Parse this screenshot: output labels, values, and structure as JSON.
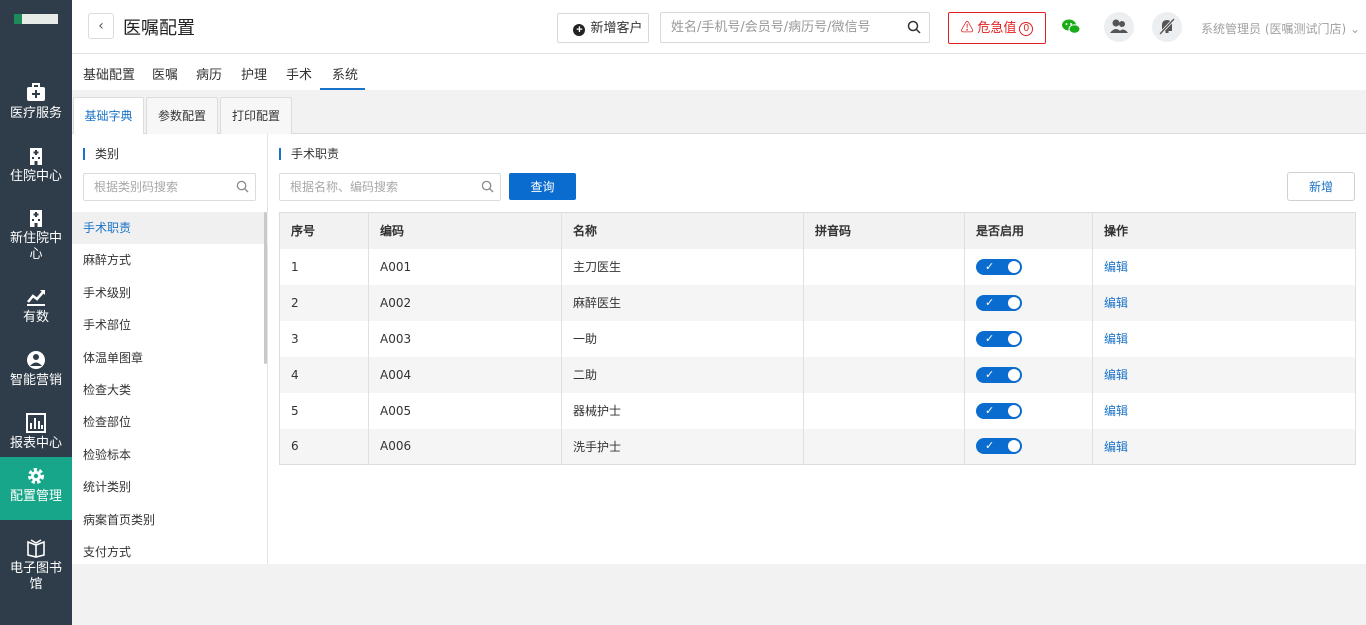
{
  "sidebar": {
    "items": [
      {
        "label": "医疗服务",
        "icon": "medical-kit-icon"
      },
      {
        "label": "住院中心",
        "icon": "hospital-building-icon"
      },
      {
        "label": "新住院中心",
        "icon": "hospital-building-icon"
      },
      {
        "label": "有数",
        "icon": "trend-chart-icon"
      },
      {
        "label": "智能营销",
        "icon": "person-marketing-icon"
      },
      {
        "label": "报表中心",
        "icon": "bar-chart-icon"
      },
      {
        "label": "配置管理",
        "icon": "gear-icon"
      },
      {
        "label": "电子图书馆",
        "icon": "book-icon"
      }
    ],
    "active_index": 6,
    "active_color": "#17a689"
  },
  "header": {
    "title": "医嘱配置",
    "add_customer_label": "新增客户",
    "search_placeholder": "姓名/手机号/会员号/病历号/微信号",
    "critical_label": "危急值",
    "critical_count": "0",
    "user": "系统管理员 (医嘱测试门店)"
  },
  "top_tabs": [
    "基础配置",
    "医嘱",
    "病历",
    "护理",
    "手术",
    "系统"
  ],
  "top_tab_active": "系统",
  "sub_tabs": [
    "基础字典",
    "参数配置",
    "打印配置"
  ],
  "sub_tab_active": "基础字典",
  "category": {
    "title": "类别",
    "search_placeholder": "根据类别码搜索",
    "items": [
      "手术职责",
      "麻醉方式",
      "手术级别",
      "手术部位",
      "体温单图章",
      "检查大类",
      "检查部位",
      "检验标本",
      "统计类别",
      "病案首页类别",
      "支付方式"
    ],
    "active": "手术职责"
  },
  "main": {
    "title": "手术职责",
    "search_placeholder": "根据名称、编码搜索",
    "query_label": "查询",
    "add_label": "新增",
    "columns": [
      "序号",
      "编码",
      "名称",
      "拼音码",
      "是否启用",
      "操作"
    ],
    "edit_label": "编辑",
    "rows": [
      {
        "no": "1",
        "code": "A001",
        "name": "主刀医生",
        "pinyin": "",
        "enabled": true
      },
      {
        "no": "2",
        "code": "A002",
        "name": "麻醉医生",
        "pinyin": "",
        "enabled": true
      },
      {
        "no": "3",
        "code": "A003",
        "name": "一助",
        "pinyin": "",
        "enabled": true
      },
      {
        "no": "4",
        "code": "A004",
        "name": "二助",
        "pinyin": "",
        "enabled": true
      },
      {
        "no": "5",
        "code": "A005",
        "name": "器械护士",
        "pinyin": "",
        "enabled": true
      },
      {
        "no": "6",
        "code": "A006",
        "name": "洗手护士",
        "pinyin": "",
        "enabled": true
      }
    ]
  },
  "colors": {
    "primary": "#0b6ccf",
    "danger": "#e02020",
    "wechat": "#1aad19"
  }
}
